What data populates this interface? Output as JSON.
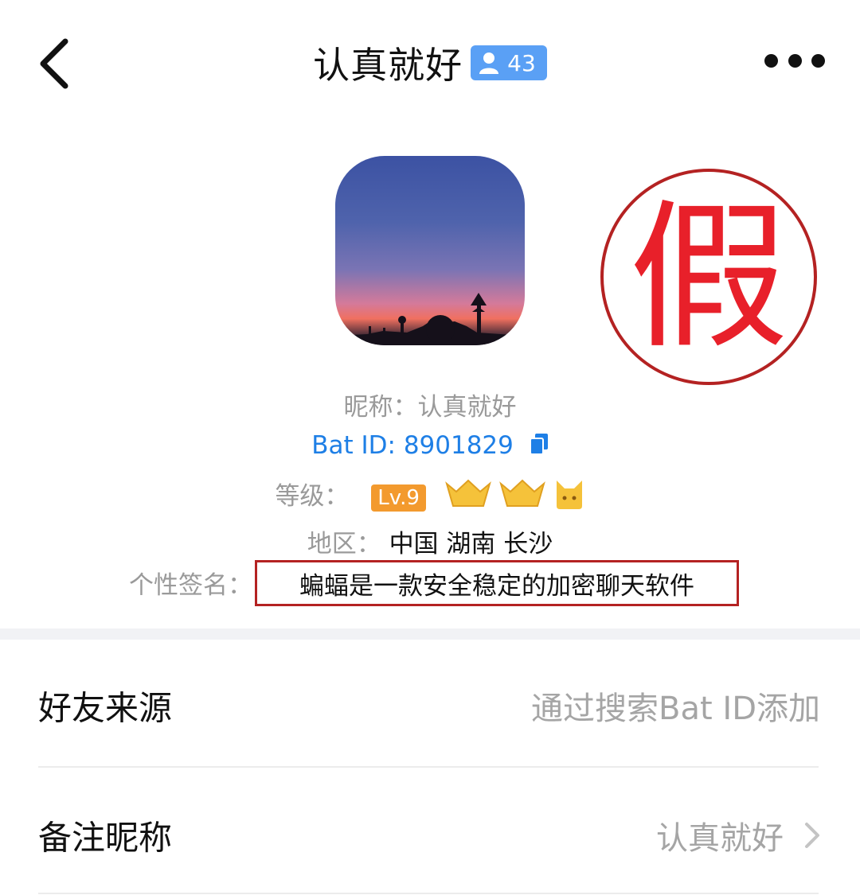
{
  "header": {
    "title": "认真就好",
    "member_count": "43"
  },
  "profile": {
    "nickname_line": "昵称：认真就好",
    "bat_id_line": "Bat ID: 8901829",
    "level_label": "等级：",
    "level_badge": "Lv.9",
    "region_label": "地区：",
    "region_value": "中国 湖南 长沙",
    "signature_label": "个性签名：",
    "signature_value": "蝙蝠是一款安全稳定的加密聊天软件"
  },
  "stamp": {
    "text": "假",
    "color": "#e8202a"
  },
  "rows": [
    {
      "label": "好友来源",
      "value": "通过搜索Bat ID添加"
    },
    {
      "label": "备注昵称",
      "value": "认真就好"
    }
  ],
  "colors": {
    "accent_blue": "#1e7fe6",
    "badge_blue": "#5aa0f5",
    "level_orange": "#f39a2e",
    "highlight_red": "#b42222"
  }
}
